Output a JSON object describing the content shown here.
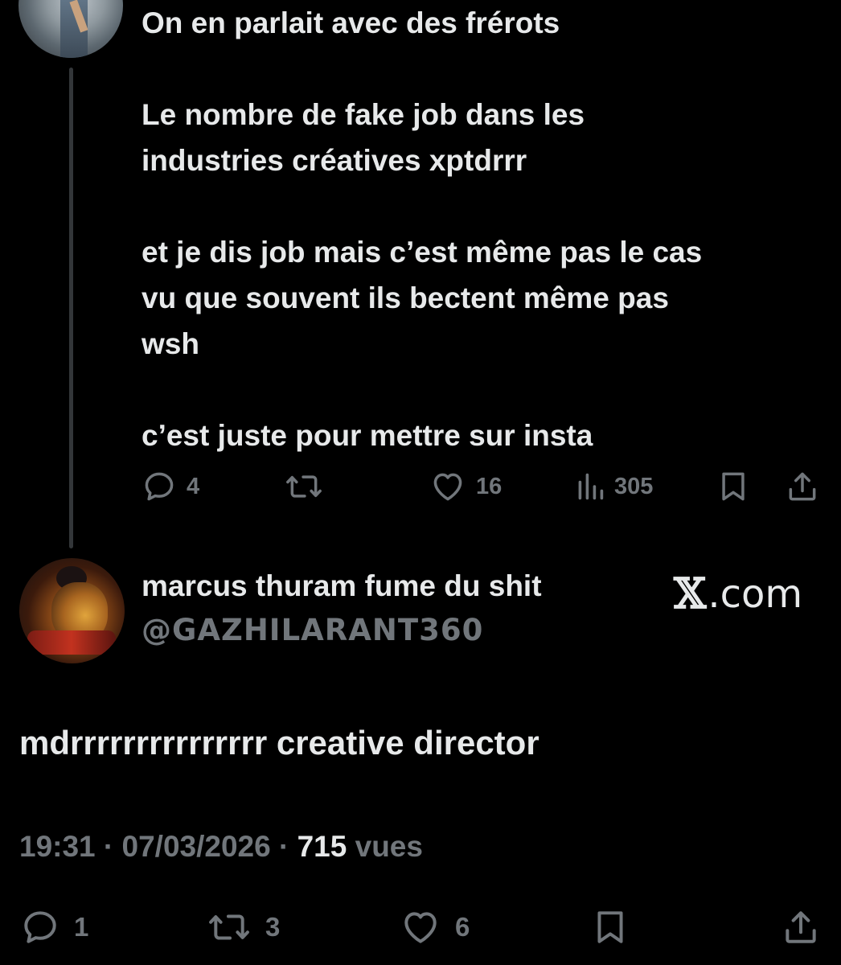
{
  "parent_tweet": {
    "paragraphs": [
      "On en parlait avec des frérots",
      "Le nombre de fake job dans les\nindustries créatives xptdrrr",
      "et je dis job mais c’est même pas le cas\nvu que souvent ils bectent même pas\nwsh",
      "c’est juste pour mettre sur insta"
    ],
    "actions": {
      "replies": "4",
      "retweets": "",
      "likes": "16",
      "views": "305"
    }
  },
  "reply_tweet": {
    "display_name": "marcus thuram fume du shit",
    "handle": "@GAZHILARANT360",
    "watermark_logo": "𝕏",
    "watermark_text": ".com",
    "text": "mdrrrrrrrrrrrrrrr creative director",
    "time": "19:31",
    "separator": " · ",
    "date": "07/03/2026",
    "views_count": "715",
    "views_label": " vues",
    "actions": {
      "replies": "1",
      "retweets": "3",
      "likes": "6"
    }
  },
  "colors": {
    "background": "#000000",
    "text_primary": "#e7e9ea",
    "text_secondary": "#71767b",
    "thread_line": "#333639"
  }
}
